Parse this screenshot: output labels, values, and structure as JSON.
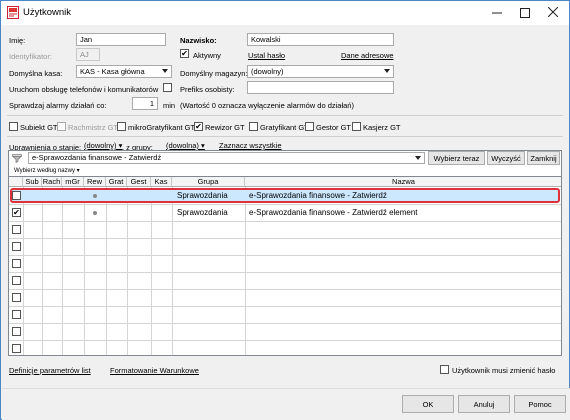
{
  "window": {
    "title": "Użytkownik"
  },
  "form": {
    "imie_label": "Imię:",
    "imie_value": "Jan",
    "nazwisko_label": "Nazwisko:",
    "nazwisko_value": "Kowalski",
    "identyfikator_label": "Identyfikator:",
    "identyfikator_value": "AJ",
    "aktywny_label": "Aktywny",
    "ustal_haslo": "Ustal hasło",
    "dane_adresowe": "Dane adresowe",
    "kasa_label": "Domyślna kasa:",
    "kasa_value": "KAS - Kasa główna",
    "magazyn_label": "Domyślny magazyn:",
    "magazyn_value": "(dowolny)",
    "uruchom_label": "Uruchom obsługę telefonów i komunikatorów",
    "prefiks_label": "Prefiks osobisty:",
    "prefiks_value": "",
    "alarmy_label": "Sprawdzaj alarmy działań co:",
    "alarmy_value": "1",
    "alarmy_unit": "min",
    "alarmy_note": "(Wartość 0 oznacza wyłączenie alarmów do działań)"
  },
  "roles": [
    {
      "label": "Subiekt GT",
      "checked": false,
      "disabled": false
    },
    {
      "label": "Rachmistrz GT",
      "checked": false,
      "disabled": true
    },
    {
      "label": "mikroGratyfikant GT",
      "checked": false,
      "disabled": false
    },
    {
      "label": "Rewizor GT",
      "checked": true,
      "disabled": false
    },
    {
      "label": "Gratyfikant GT",
      "checked": false,
      "disabled": false
    },
    {
      "label": "Gestor GT",
      "checked": false,
      "disabled": false
    },
    {
      "label": "Kasjerz GT",
      "checked": false,
      "disabled": false
    }
  ],
  "filter": {
    "stan_label": "Uprawnienia o stanie:",
    "stan_value": "(dowolny)",
    "grupa_label": ", z grupy:",
    "grupa_value": "(dowolna)",
    "zaznacz": "Zaznacz wszystkie"
  },
  "search": {
    "value": "e-Sprawozdania finansowe - Zatwierdź",
    "wybierz_teraz": "Wybierz teraz",
    "wyczysc": "Wyczyść",
    "zamknij": "Zamknij",
    "wybierz_wedlug": "Wybierz według nazwy"
  },
  "grid": {
    "columns": [
      "Sub",
      "Rach",
      "mGr",
      "Rew",
      "Grat",
      "Gest",
      "Kas",
      "Grupa",
      "Nazwa"
    ],
    "rows": [
      {
        "checked": false,
        "rew_dot": true,
        "grupa": "Sprawozdania",
        "nazwa": "e-Sprawozdania finansowe - Zatwierdź",
        "selected": true
      },
      {
        "checked": true,
        "rew_dot": true,
        "grupa": "Sprawozdania",
        "nazwa": "e-Sprawozdania finansowe - Zatwierdź element",
        "selected": false
      }
    ]
  },
  "footer": {
    "definicje": "Definicje parametrów list",
    "formatowanie": "Formatowanie Warunkowe",
    "musi_zmienic": "Użytkownik musi zmienić hasło"
  },
  "buttons": {
    "ok": "OK",
    "anuluj": "Anuluj",
    "pomoc": "Pomoc"
  },
  "colors": {
    "selection": "#cce8ff",
    "highlight_border": "#e0303a",
    "accent": "#4a86c8"
  }
}
